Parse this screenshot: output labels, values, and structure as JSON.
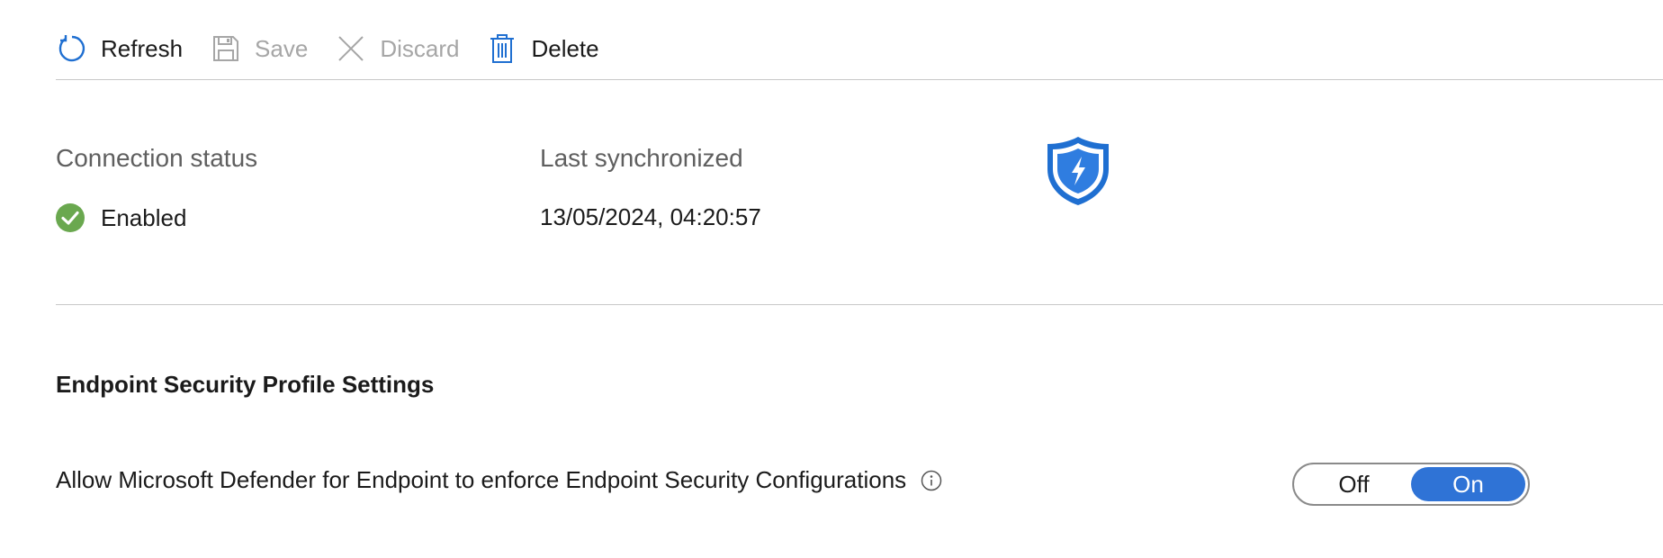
{
  "toolbar": {
    "refresh_label": "Refresh",
    "save_label": "Save",
    "discard_label": "Discard",
    "delete_label": "Delete"
  },
  "status": {
    "connection_label": "Connection status",
    "connection_value": "Enabled",
    "sync_label": "Last synchronized",
    "sync_value": "13/05/2024, 04:20:57"
  },
  "settings": {
    "section_title": "Endpoint Security Profile Settings",
    "allow_label": "Allow Microsoft Defender for Endpoint to enforce Endpoint Security Configurations",
    "toggle": {
      "off_label": "Off",
      "on_label": "On",
      "selected": "On"
    }
  },
  "colors": {
    "accent": "#2f73d6",
    "success": "#6aa84f",
    "icon_blue": "#1f6fd1"
  },
  "icons": [
    "refresh-icon",
    "save-icon",
    "discard-icon",
    "delete-icon",
    "check-circle-icon",
    "defender-shield-icon",
    "info-icon"
  ]
}
